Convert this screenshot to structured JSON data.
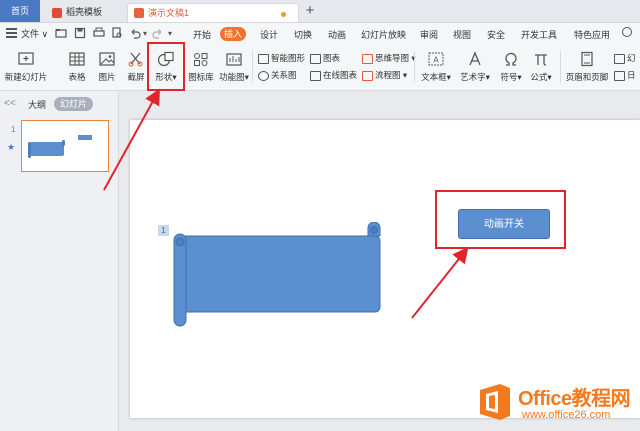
{
  "titlebar": {
    "home_tab": "首页",
    "template_tab": "稻壳模板",
    "doc_tab": "演示文稿1",
    "new_tab": "+"
  },
  "menubar": {
    "file": "文件",
    "items": [
      "开始",
      "插入",
      "设计",
      "切换",
      "动画",
      "幻灯片放映",
      "审阅",
      "视图",
      "安全",
      "开发工具",
      "特色应用"
    ],
    "active_item": "插入",
    "search_label": "Q"
  },
  "ribbon": {
    "new_slide": "新建幻灯片",
    "table": "表格",
    "picture": "图片",
    "screenshot": "截屏",
    "shape": "形状",
    "icon_lib": "图标库",
    "function_chart": "功能图",
    "smart_art": "智能图形",
    "relation": "关系图",
    "chart": "图表",
    "online_chart": "在线图表",
    "mind_map": "思维导图",
    "flowchart": "流程图",
    "textbox": "文本框",
    "art_text": "艺术字",
    "symbol": "符号",
    "formula": "公式",
    "header_footer": "页眉和页脚",
    "slide_num_partial": "幻",
    "date_partial": "日"
  },
  "left_pane": {
    "collapse_glyph": "<<",
    "outline_tab": "大纲",
    "slides_tab": "幻灯片",
    "slide_number": "1",
    "star": "★"
  },
  "slide": {
    "badge": "1",
    "button_label": "动画开关"
  },
  "watermark": {
    "title": "Office教程网",
    "url": "www.office26.com"
  },
  "colors": {
    "accent_orange": "#f0712b",
    "scroll_blue": "#5b8fd0",
    "highlight_red": "#e0262d",
    "watermark_orange": "#f47a20"
  }
}
